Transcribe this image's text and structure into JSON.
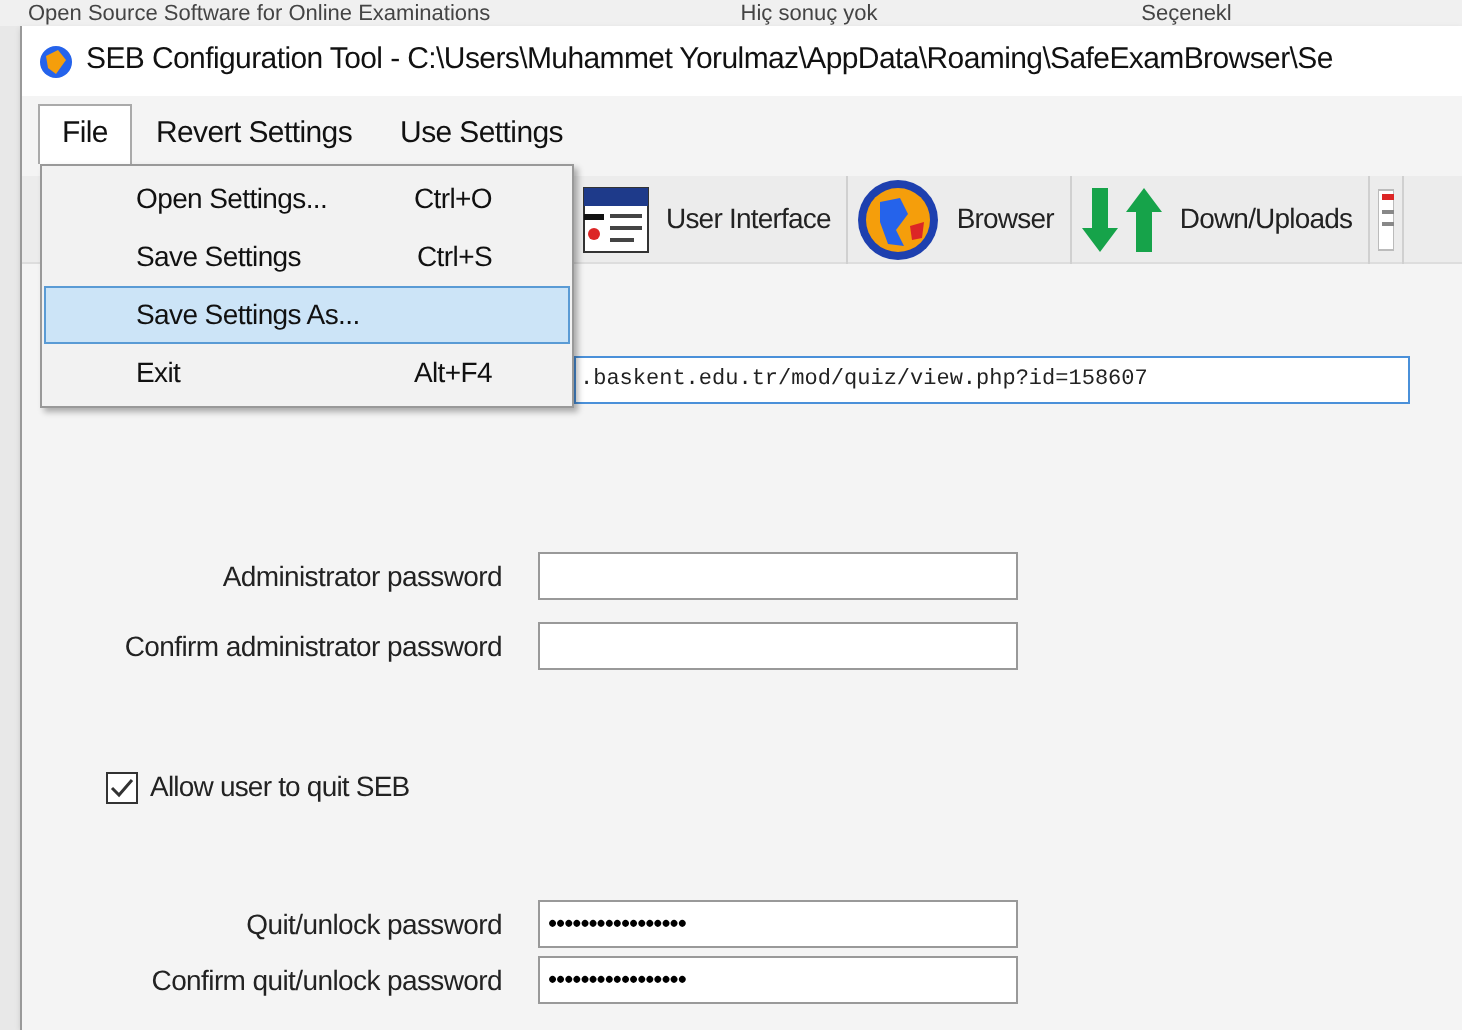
{
  "background_tabs": [
    {
      "label": "Open Source Software for Online Examinations"
    },
    {
      "label": "Hiç sonuç yok"
    },
    {
      "label": "Seçenekl"
    }
  ],
  "window": {
    "title": "SEB Configuration Tool - C:\\Users\\Muhammet Yorulmaz\\AppData\\Roaming\\SafeExamBrowser\\Se"
  },
  "menu_bar": [
    {
      "label": "File",
      "selected": true
    },
    {
      "label": "Revert Settings",
      "selected": false
    },
    {
      "label": "Use Settings",
      "selected": false
    }
  ],
  "file_menu": [
    {
      "label": "Open Settings...",
      "shortcut": "Ctrl+O",
      "selected": false
    },
    {
      "label": "Save Settings",
      "shortcut": "Ctrl+S",
      "selected": false
    },
    {
      "label": "Save Settings As...",
      "selected": true
    },
    {
      "label": "Exit",
      "shortcut": "Alt+F4",
      "selected": false
    }
  ],
  "toolbar": [
    {
      "kind": "file",
      "label": "User Interface"
    },
    {
      "kind": "globe",
      "label": "Browser"
    },
    {
      "kind": "arrows",
      "label": "Down/Uploads"
    },
    {
      "kind": "cut"
    }
  ],
  "start_url": {
    "value": ".baskent.edu.tr/mod/quiz/view.php?id=158607"
  },
  "admin_fields": [
    {
      "label": "Administrator password"
    },
    {
      "label": "Confirm administrator password"
    }
  ],
  "allow_quit": {
    "label": "Allow user to quit SEB",
    "checked": true
  },
  "quit_fields": [
    {
      "label": "Quit/unlock password",
      "value": "•••••••••••••••••"
    },
    {
      "label": "Confirm quit/unlock password",
      "value": "•••••••••••••••••"
    }
  ]
}
